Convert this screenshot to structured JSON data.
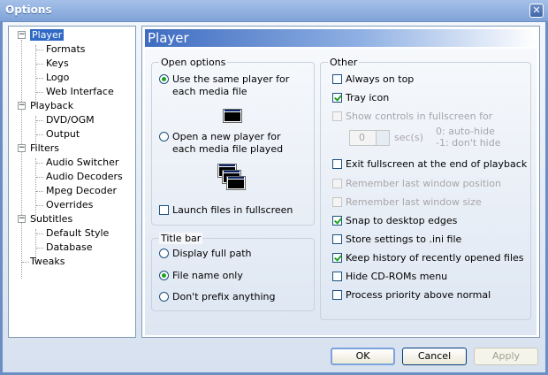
{
  "window": {
    "title": "Options",
    "close_icon": "close-icon"
  },
  "tree": {
    "items": [
      {
        "label": "Player",
        "selected": true
      },
      {
        "label": "Formats"
      },
      {
        "label": "Keys"
      },
      {
        "label": "Logo"
      },
      {
        "label": "Web Interface"
      },
      {
        "label": "Playback"
      },
      {
        "label": "DVD/OGM"
      },
      {
        "label": "Output"
      },
      {
        "label": "Filters"
      },
      {
        "label": "Audio Switcher"
      },
      {
        "label": "Audio Decoders"
      },
      {
        "label": "Mpeg Decoder"
      },
      {
        "label": "Overrides"
      },
      {
        "label": "Subtitles"
      },
      {
        "label": "Default Style"
      },
      {
        "label": "Database"
      },
      {
        "label": "Tweaks"
      }
    ]
  },
  "panel": {
    "title": "Player",
    "open_options": {
      "title": "Open options",
      "same_player_line1": "Use the same player for",
      "same_player_line2": "each media file",
      "new_player_line1": "Open a new player for",
      "new_player_line2": "each media file played",
      "launch_fullscreen": "Launch files in fullscreen",
      "selected": "same_player"
    },
    "title_bar": {
      "title": "Title bar",
      "options": [
        "Display full path",
        "File name only",
        "Don't prefix anything"
      ],
      "selected": "File name only"
    },
    "other": {
      "title": "Other",
      "always_on_top": {
        "label": "Always on top",
        "checked": false
      },
      "tray_icon": {
        "label": "Tray icon",
        "checked": true
      },
      "show_controls": {
        "label": "Show controls in fullscreen for",
        "checked": false,
        "disabled": true
      },
      "spin_value": "0",
      "spin_unit": "sec(s)",
      "hint_line1": "0: auto-hide",
      "hint_line2": "-1: don't hide",
      "exit_fullscreen": {
        "label": "Exit fullscreen at the end of playback",
        "checked": false
      },
      "remember_position": {
        "label": "Remember last window position",
        "checked": false,
        "disabled": true
      },
      "remember_size": {
        "label": "Remember last window size",
        "checked": false,
        "disabled": true
      },
      "snap_edges": {
        "label": "Snap to desktop edges",
        "checked": true
      },
      "store_ini": {
        "label": "Store settings to .ini file",
        "checked": false
      },
      "keep_history": {
        "label": "Keep history of recently opened files",
        "checked": true
      },
      "hide_cdroms": {
        "label": "Hide CD-ROMs menu",
        "checked": false
      },
      "process_priority": {
        "label": "Process priority above normal",
        "checked": false
      }
    }
  },
  "buttons": {
    "ok": "OK",
    "cancel": "Cancel",
    "apply": "Apply"
  },
  "colors": {
    "selection": "#316ac5",
    "check_green": "#21a121",
    "header_blue": "#3e6cc0"
  }
}
